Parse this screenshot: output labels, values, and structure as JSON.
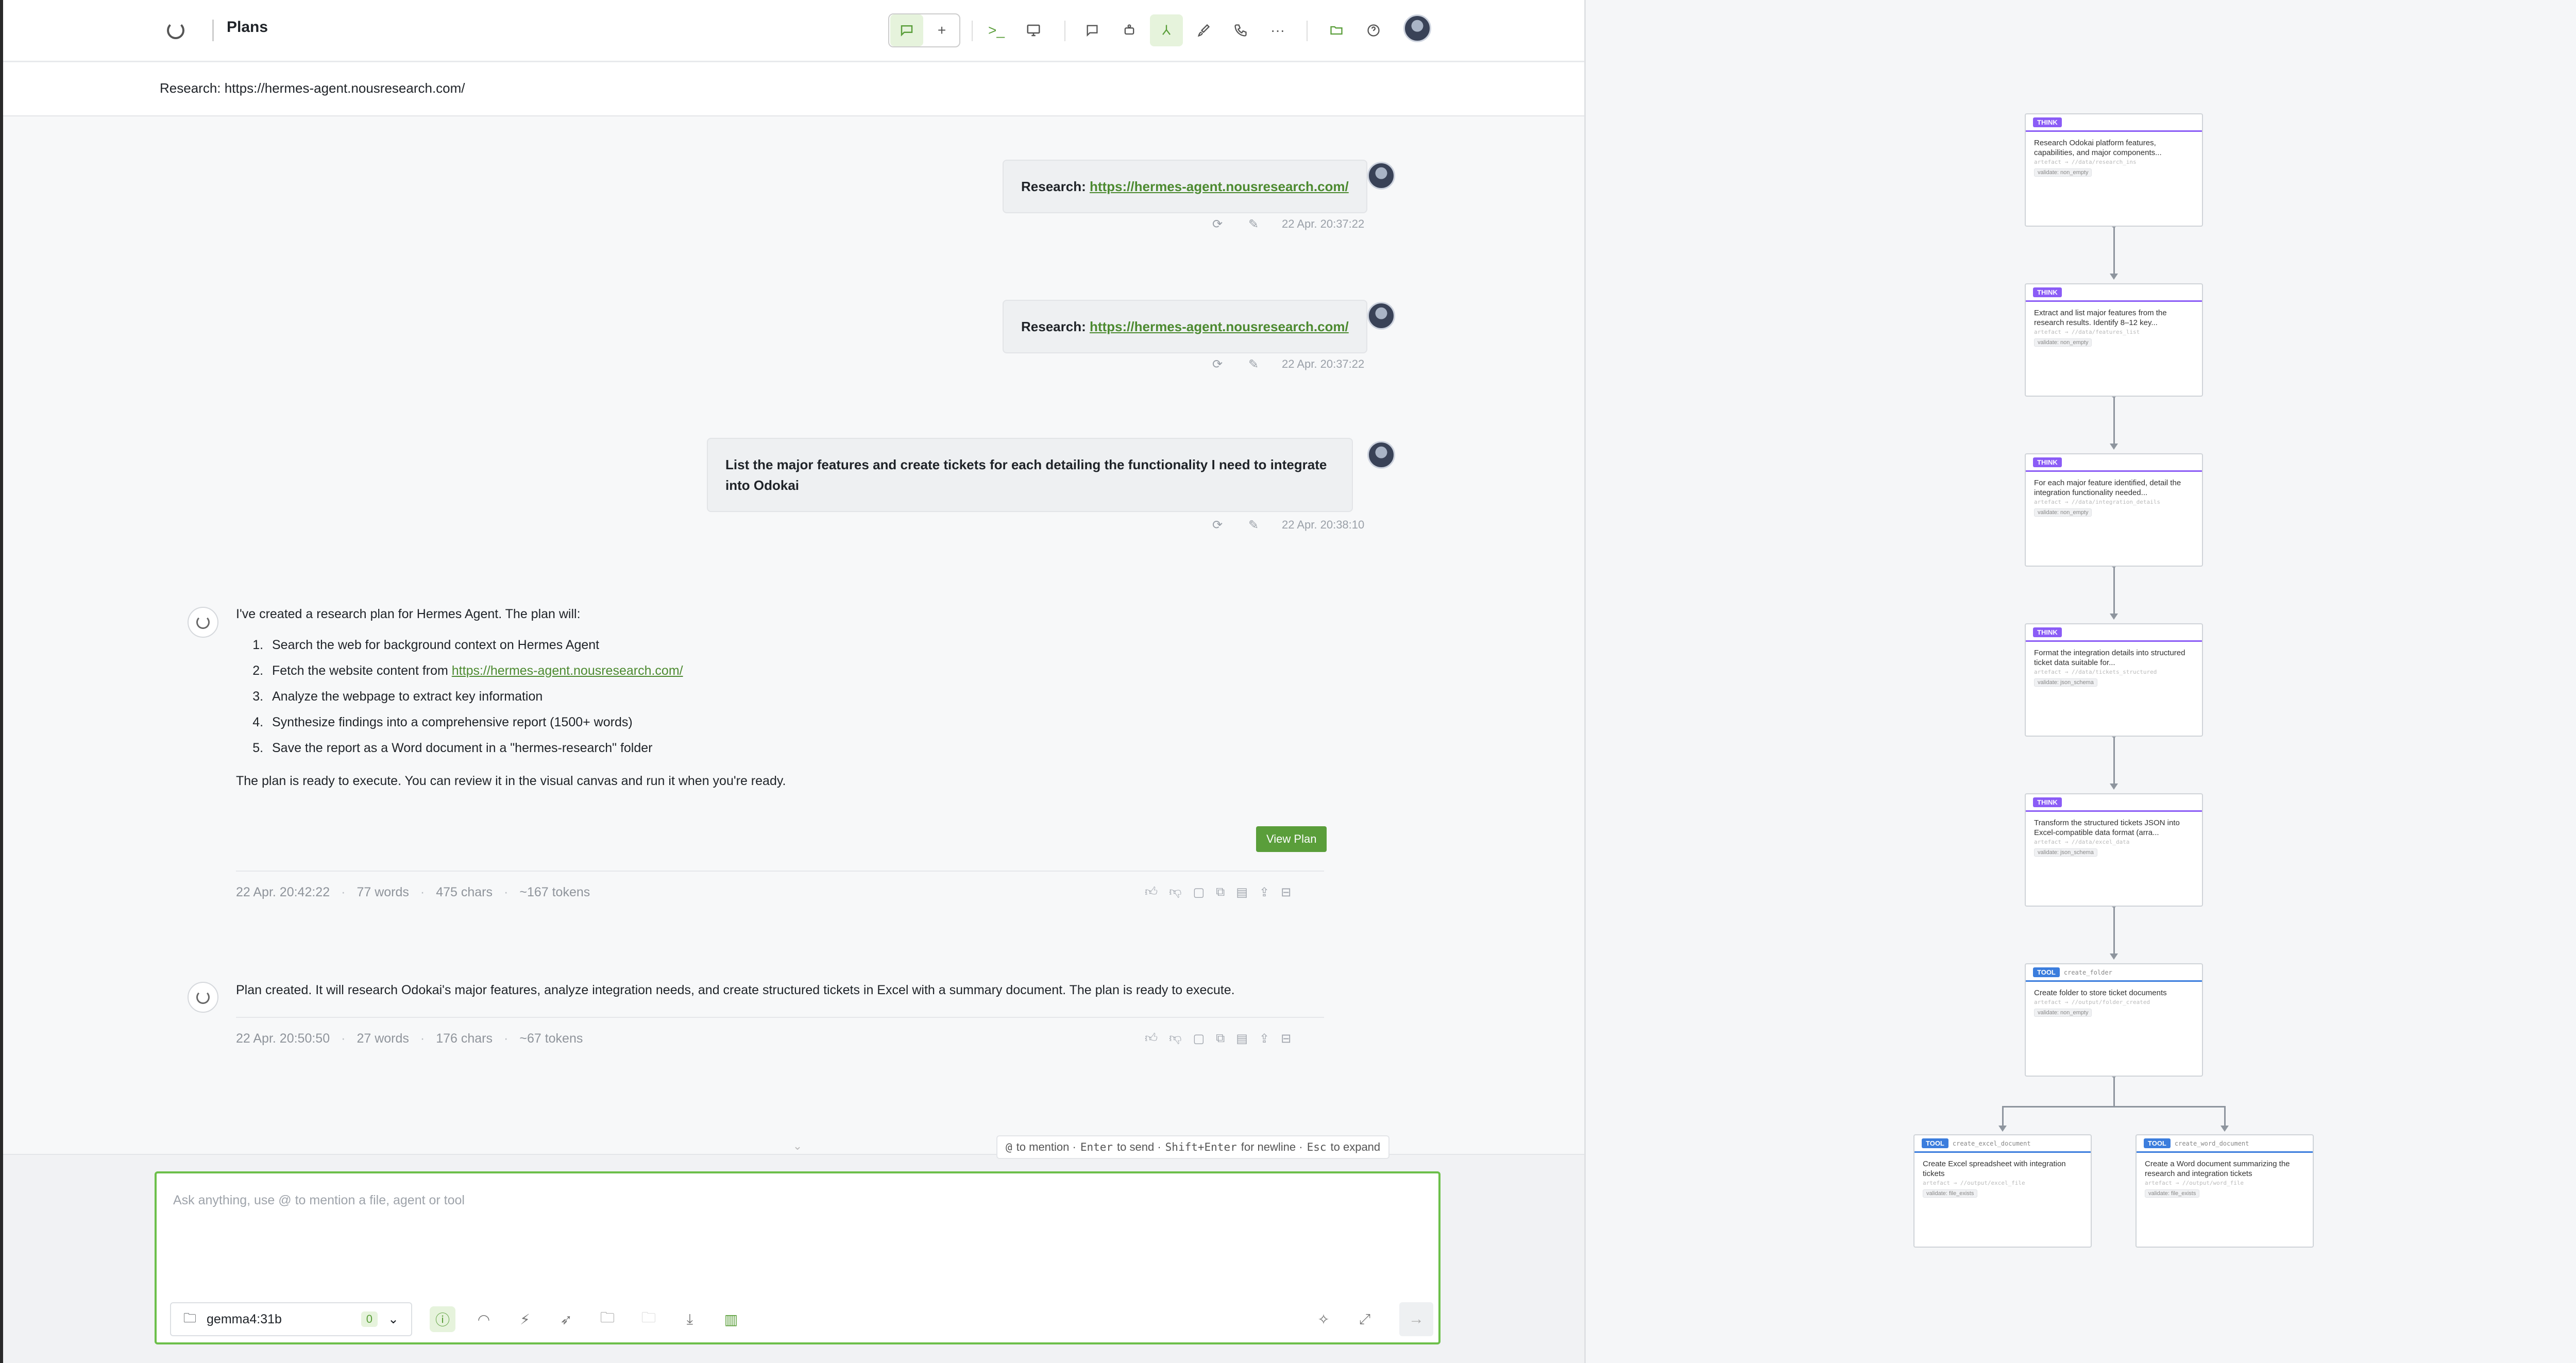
{
  "header": {
    "title": "Plans",
    "subtitle": "Research: https://hermes-agent.nousresearch.com/"
  },
  "messages": {
    "user1": {
      "prefix": "Research: ",
      "link": "https://hermes-agent.nousresearch.com/",
      "time": "22 Apr. 20:37:22"
    },
    "user2": {
      "prefix": "Research: ",
      "link": "https://hermes-agent.nousresearch.com/",
      "time": "22 Apr. 20:37:22"
    },
    "user3": {
      "text": "List the major features and create tickets for each detailing the functionality I need to integrate into Odokai",
      "time": "22 Apr. 20:38:10"
    },
    "ai1": {
      "intro": "I've created a research plan for Hermes Agent. The plan will:",
      "steps": [
        "Search the web for background context on Hermes Agent",
        "Fetch the website content from ",
        "Analyze the webpage to extract key information",
        "Synthesize findings into a comprehensive report (1500+ words)",
        "Save the report as a Word document in a \"hermes-research\" folder"
      ],
      "step2_link": "https://hermes-agent.nousresearch.com/",
      "outro": "The plan is ready to execute. You can review it in the visual canvas and run it when you're ready.",
      "button": "View Plan",
      "time": "22 Apr. 20:42:22",
      "words": "77 words",
      "chars": "475 chars",
      "tokens": "~167 tokens"
    },
    "ai2": {
      "text": "Plan created. It will research Odokai's major features, analyze integration needs, and create structured tickets in Excel with a summary document. The plan is ready to execute.",
      "time": "22 Apr. 20:50:50",
      "words": "27 words",
      "chars": "176 chars",
      "tokens": "~67 tokens"
    }
  },
  "composer": {
    "hint_mention_key": "@",
    "hint_mention": "to mention ·",
    "hint_send_key": "Enter",
    "hint_send": "to send ·",
    "hint_newline_key": "Shift+Enter",
    "hint_newline": "for newline ·",
    "hint_expand_key": "Esc",
    "hint_expand": "to expand",
    "placeholder": "Ask anything, use @ to mention a file, agent or tool",
    "model": "gemma4:31b",
    "model_count": "0"
  },
  "canvas": {
    "nodes": [
      {
        "tag": "THINK",
        "desc": "Research Odokai platform features, capabilities, and major components...",
        "art": "artefact → //data/research_ins",
        "chip": "validate: non_empty"
      },
      {
        "tag": "THINK",
        "desc": "Extract and list major features from the research results. Identify 8–12 key...",
        "art": "artefact → //data/features_list",
        "chip": "validate: non_empty"
      },
      {
        "tag": "THINK",
        "desc": "For each major feature identified, detail the integration functionality needed...",
        "art": "artefact → //data/integration_details",
        "chip": "validate: non_empty"
      },
      {
        "tag": "THINK",
        "desc": "Format the integration details into structured ticket data suitable for...",
        "art": "artefact → //data/tickets_structured",
        "chip": "validate: json_schema"
      },
      {
        "tag": "THINK",
        "desc": "Transform the structured tickets JSON into Excel-compatible data format (arra...",
        "art": "artefact → //data/excel_data",
        "chip": "validate: json_schema"
      },
      {
        "tag": "TOOL",
        "tool": "create_folder",
        "desc": "Create folder to store ticket documents",
        "art": "artefact → //output/folder_created",
        "chip": "validate: non_empty"
      },
      {
        "tag": "TOOL",
        "tool": "create_excel_document",
        "desc": "Create Excel spreadsheet with integration tickets",
        "art": "artefact → //output/excel_file",
        "chip": "validate: file_exists"
      },
      {
        "tag": "TOOL",
        "tool": "create_word_document",
        "desc": "Create a Word document summarizing the research and integration tickets",
        "art": "artefact → //output/word_file",
        "chip": "validate: file_exists"
      }
    ]
  }
}
